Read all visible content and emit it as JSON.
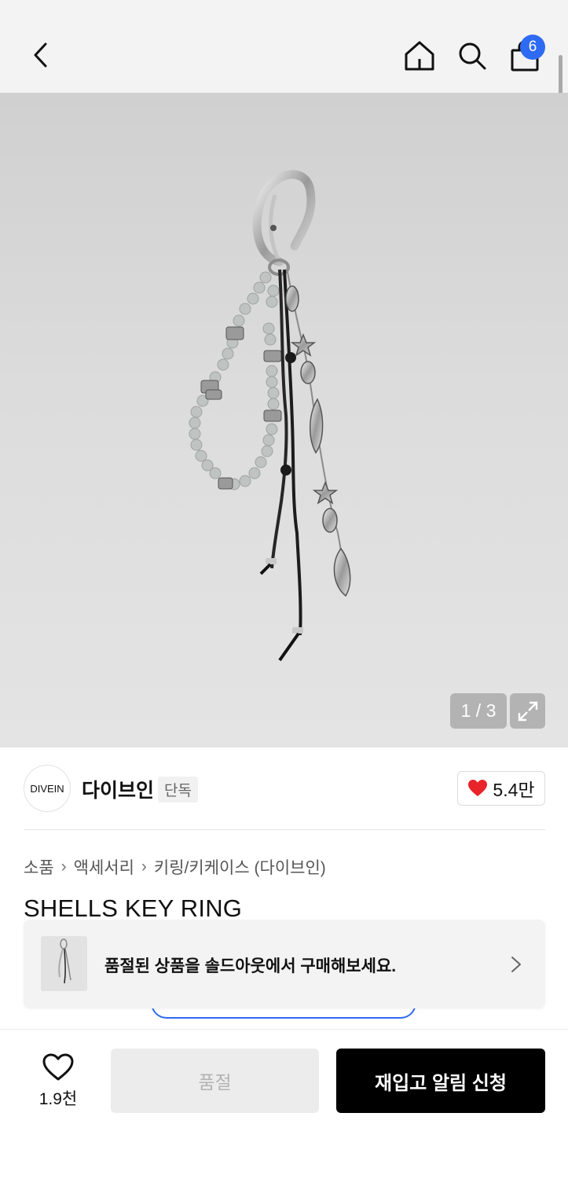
{
  "header": {
    "back_icon": "chevron-left-icon",
    "home_icon": "home-icon",
    "search_icon": "search-icon",
    "cart_icon": "shopping-bag-icon",
    "cart_count": "6",
    "badge_color": "#2f6bf2"
  },
  "gallery": {
    "counter": "1 / 3",
    "current": 1,
    "total": 3,
    "expand_icon": "expand-icon"
  },
  "brand": {
    "logo_text": "DIVEIN",
    "name": "다이브인",
    "tag": "단독",
    "likes": "5.4만",
    "like_icon": "heart-filled-icon",
    "heart_color": "#e8242a"
  },
  "breadcrumb": {
    "items": [
      "소품",
      "액세서리",
      "키링/키케이스 (다이브인)"
    ]
  },
  "product": {
    "title": "SHELLS KEY RING"
  },
  "toast": {
    "message": "품절된 상품을 솔드아웃에서 구매해보세요.",
    "chevron_icon": "chevron-right-icon"
  },
  "bottom_bar": {
    "wish_icon": "heart-outline-icon",
    "wish_count": "1.9천",
    "soldout_label": "품절",
    "restock_label": "재입고 알림 신청"
  }
}
